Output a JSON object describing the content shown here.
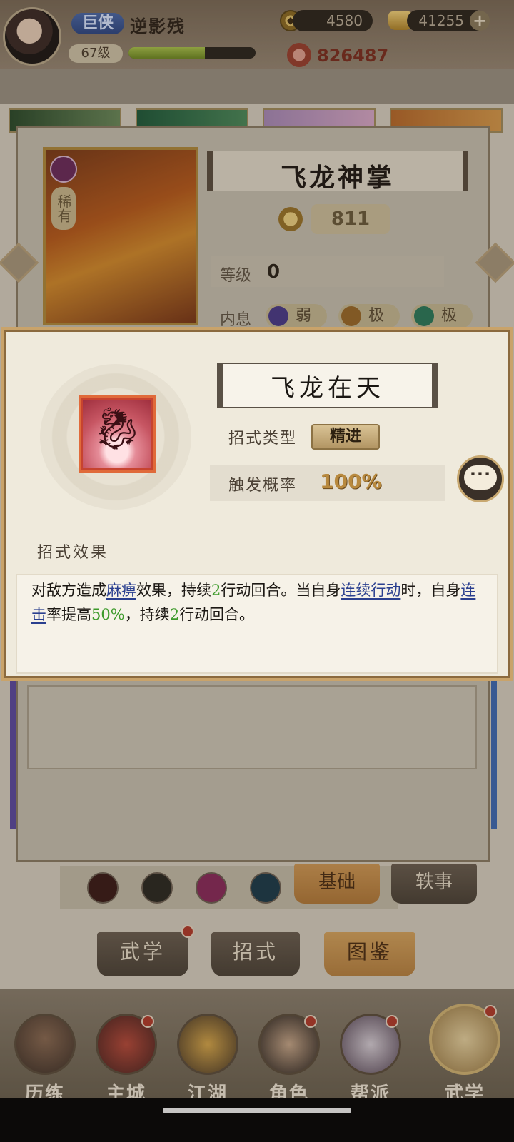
{
  "header": {
    "rank": "巨侠",
    "player_name": "逆影残",
    "level": "67级",
    "exp_fraction": 0.6,
    "copper": "4580",
    "gold": "41255",
    "power": "826487"
  },
  "skill": {
    "name": "飞龙神掌",
    "rarity": "稀有",
    "score": "811",
    "level_label": "等级",
    "level_value": "0",
    "inner_label": "内息",
    "inner_chips": [
      "弱",
      "极",
      "极"
    ]
  },
  "sub_tabs": {
    "basic": "基础",
    "anecdote": "轶事"
  },
  "main_tabs": {
    "martial": "武学",
    "moves": "招式",
    "codex": "图鉴"
  },
  "bottom_nav": {
    "items": [
      {
        "label": "历练"
      },
      {
        "label": "主城"
      },
      {
        "label": "江湖"
      },
      {
        "label": "角色"
      },
      {
        "label": "帮派"
      },
      {
        "label": "武学"
      }
    ]
  },
  "popup": {
    "move_name": "飞龙在天",
    "type_label": "招式类型",
    "type_value": "精进",
    "trigger_label": "触发概率",
    "trigger_value": "100%",
    "effect_title": "招式效果",
    "effect": {
      "p1": "对敌方造成",
      "kw1": "麻痹",
      "p2": "效果，持续",
      "n1": "2",
      "p3": "行动回合。当自身",
      "kw2": "连续行动",
      "p4": "时，自身",
      "kw3": "连击",
      "p5": "率提高",
      "n2": "50%",
      "p6": "，持续",
      "n3": "2",
      "p7": "行动回合。"
    }
  },
  "colors": {
    "keyword": "#2a3f8f",
    "number": "#3c9a2a",
    "trigger_value": "#b8893e"
  }
}
